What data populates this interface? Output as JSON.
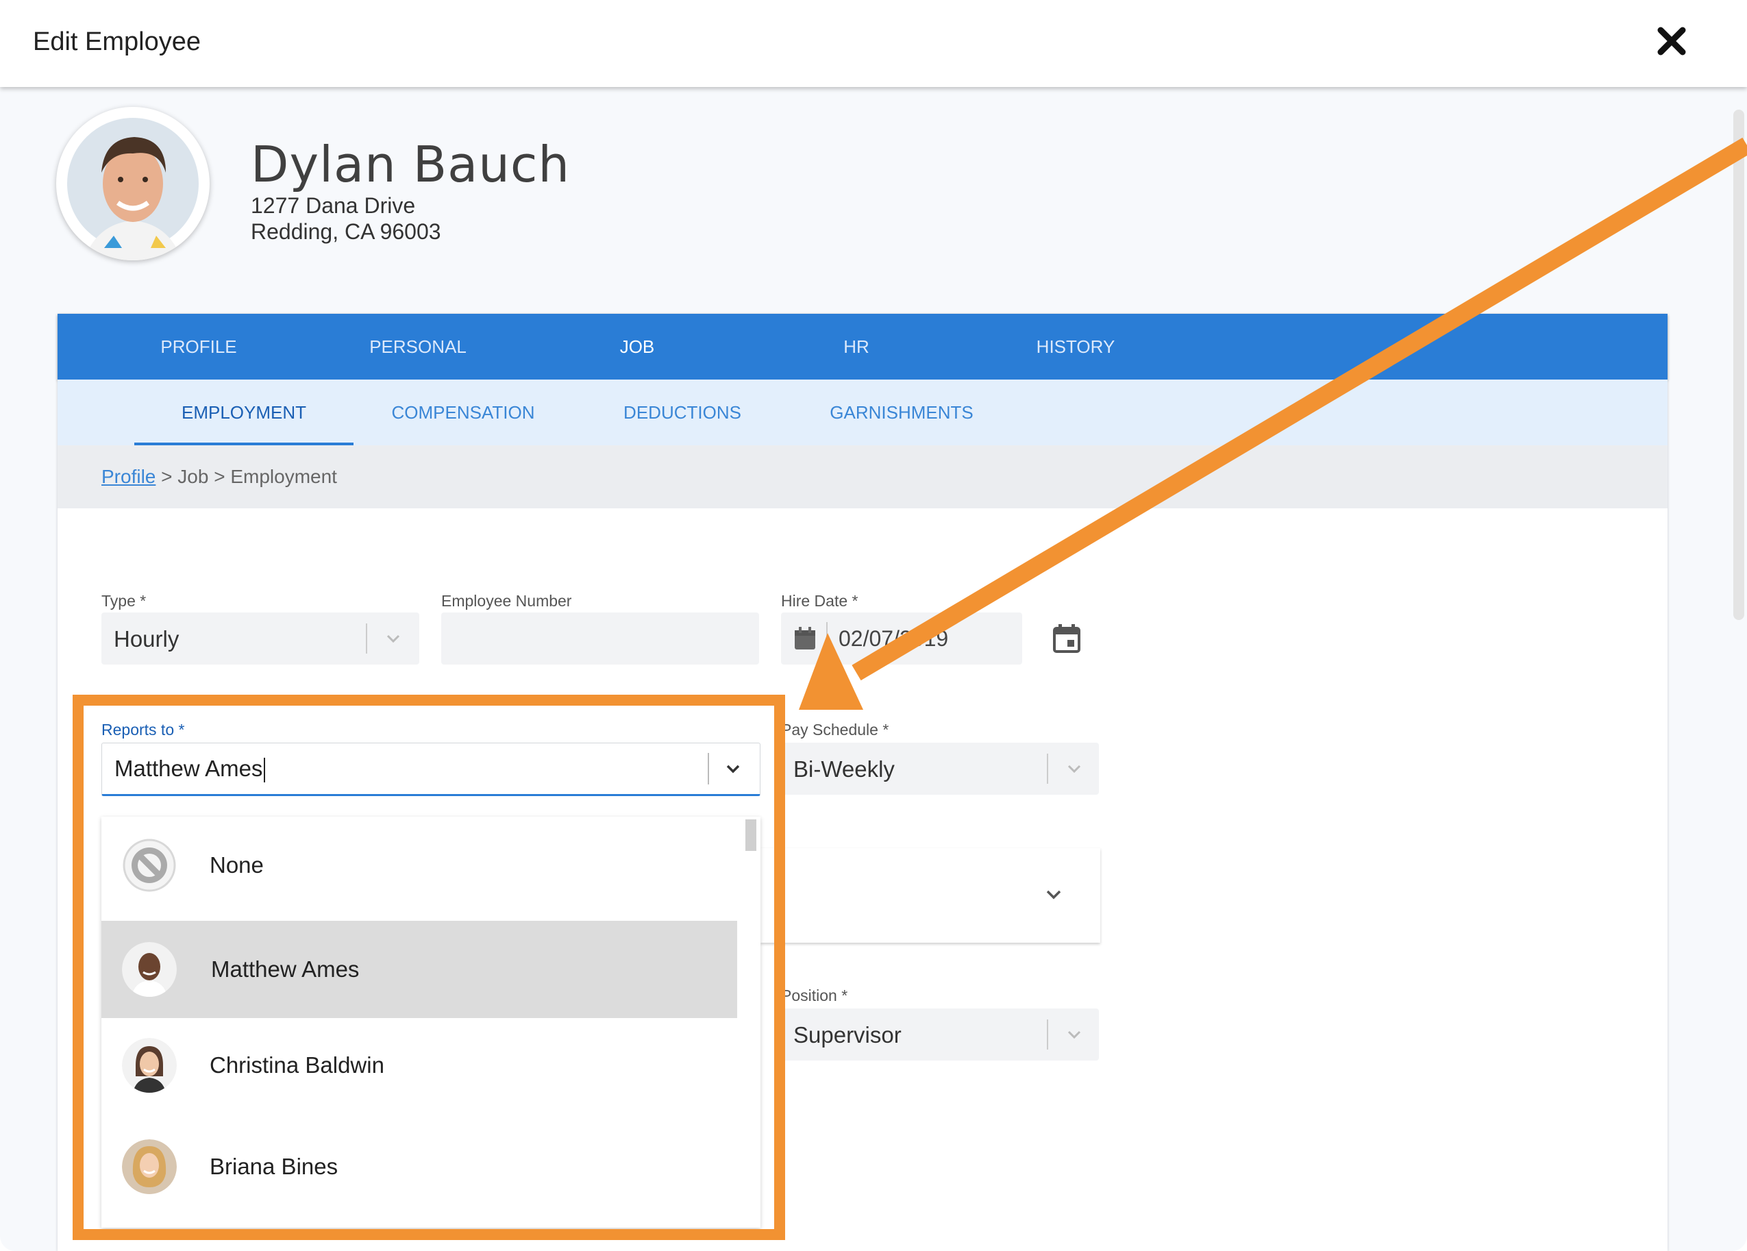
{
  "modal": {
    "title": "Edit Employee"
  },
  "employee": {
    "name": "Dylan Bauch",
    "address_line1": "1277 Dana Drive",
    "address_line2": "Redding, CA 96003"
  },
  "main_tabs": [
    {
      "label": "PROFILE",
      "active": false
    },
    {
      "label": "PERSONAL",
      "active": false
    },
    {
      "label": "JOB",
      "active": true
    },
    {
      "label": "HR",
      "active": false
    },
    {
      "label": "HISTORY",
      "active": false
    }
  ],
  "sub_tabs": [
    {
      "label": "EMPLOYMENT",
      "active": true
    },
    {
      "label": "COMPENSATION",
      "active": false
    },
    {
      "label": "DEDUCTIONS",
      "active": false
    },
    {
      "label": "GARNISHMENTS",
      "active": false
    }
  ],
  "breadcrumb": {
    "link": "Profile",
    "rest": " > Job > Employment"
  },
  "form": {
    "type": {
      "label": "Type *",
      "value": "Hourly"
    },
    "employee_number": {
      "label": "Employee Number",
      "value": ""
    },
    "hire_date": {
      "label": "Hire Date *",
      "value": "02/07/2019"
    },
    "reports_to": {
      "label": "Reports to *",
      "value": "Matthew Ames"
    },
    "pay_schedule": {
      "label": "Pay Schedule *",
      "value": "Bi-Weekly"
    },
    "position": {
      "label": "Position *",
      "value": "Supervisor"
    }
  },
  "reports_to_options": [
    {
      "label": "None",
      "icon": "none-icon",
      "selected": false
    },
    {
      "label": "Matthew Ames",
      "icon": "avatar",
      "selected": true
    },
    {
      "label": "Christina Baldwin",
      "icon": "avatar",
      "selected": false
    },
    {
      "label": "Briana Bines",
      "icon": "avatar",
      "selected": false
    }
  ],
  "colors": {
    "primary_blue": "#2a7dd6",
    "subtab_bg": "#e3effc",
    "highlight_orange": "#f29232",
    "selected_row": "#dcdcdc"
  }
}
